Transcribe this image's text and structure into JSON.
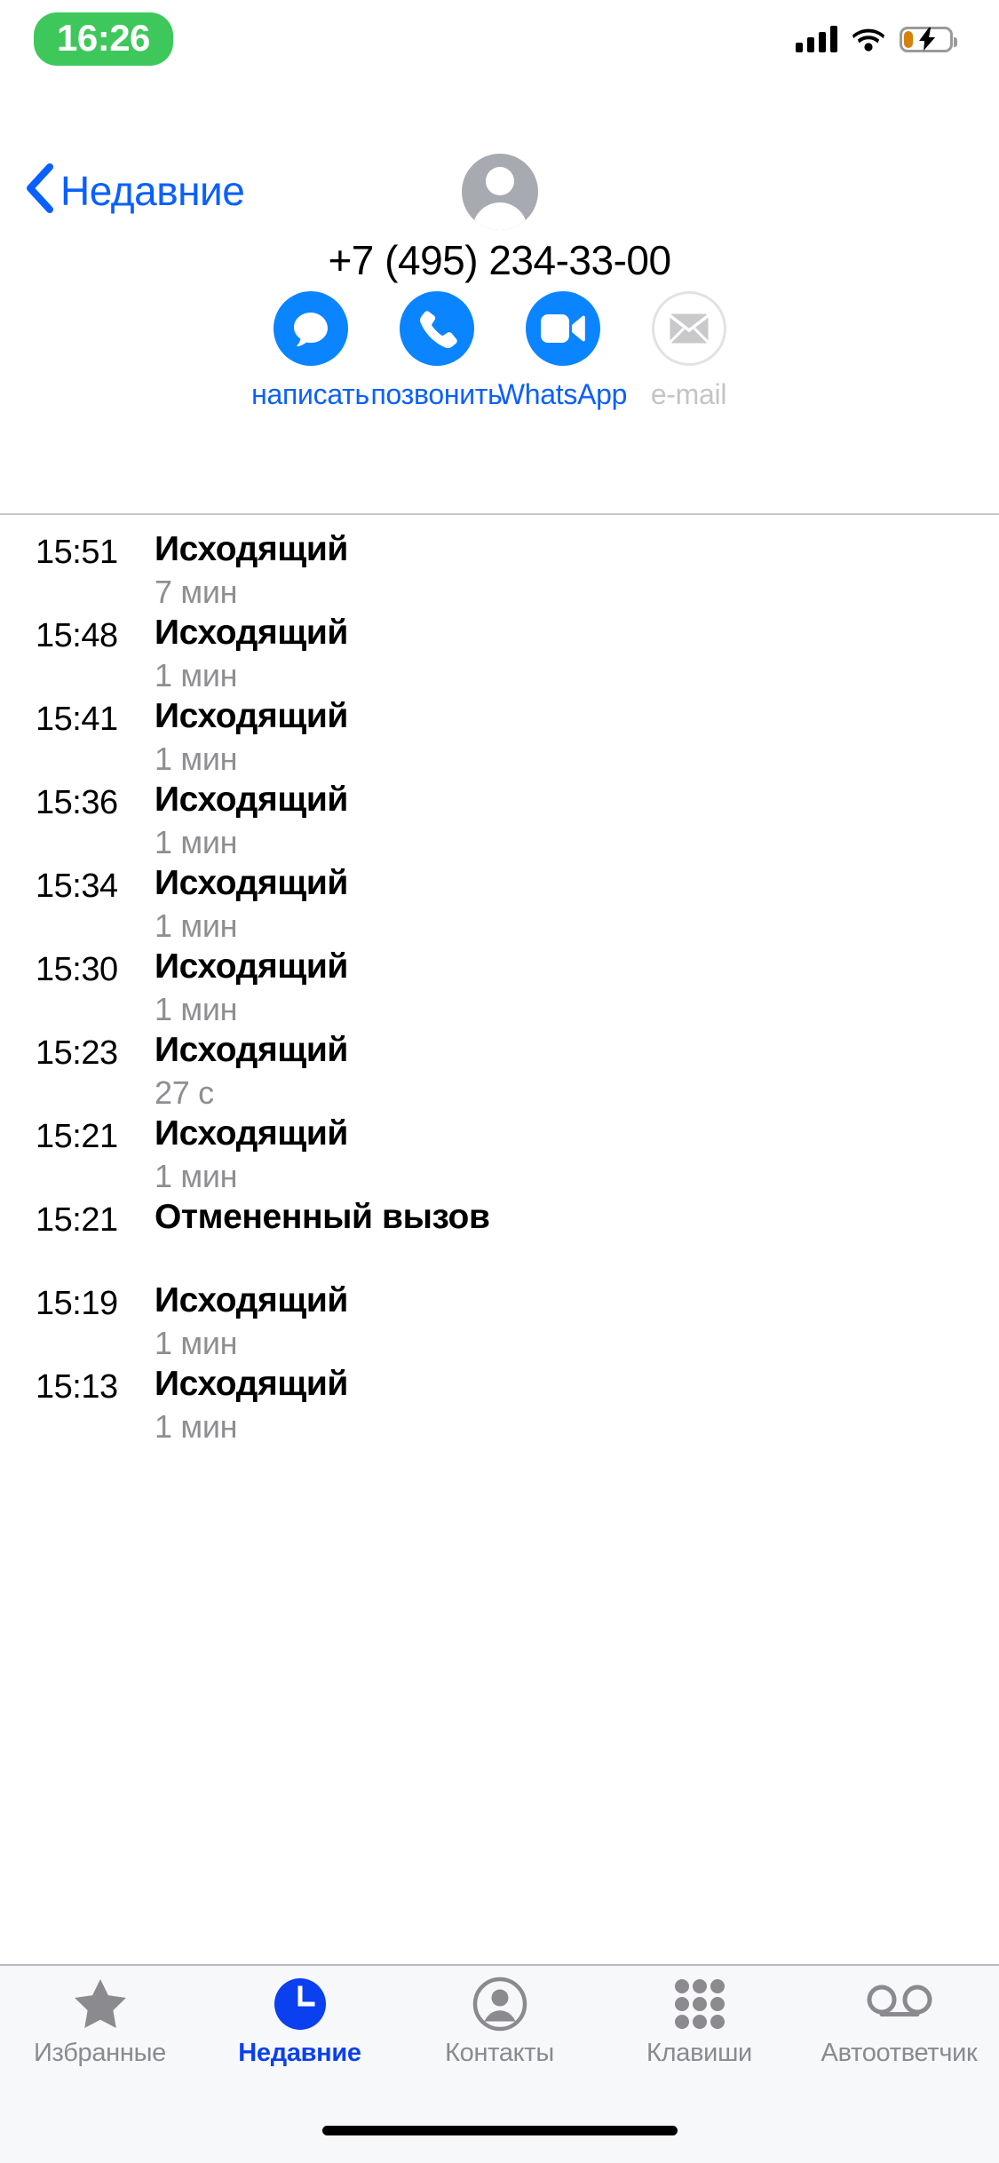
{
  "status_bar": {
    "time": "16:26",
    "time_pill_color": "#3ec85b",
    "signal_icon": "cellular-signal-icon",
    "wifi_icon": "wifi-icon",
    "battery_icon": "battery-charging-icon",
    "battery_fill_color": "#d4820a"
  },
  "nav": {
    "back_label": "Недавние",
    "back_chevron": "‹",
    "accent_color": "#0a60ff"
  },
  "contact": {
    "avatar_icon": "person-placeholder-avatar",
    "phone_number": "+7 (495) 234-33-00"
  },
  "actions": [
    {
      "label": "написать",
      "icon": "message-bubble-icon",
      "enabled": true
    },
    {
      "label": "позвонить",
      "icon": "phone-handset-icon",
      "enabled": true
    },
    {
      "label": "WhatsApp",
      "icon": "video-camera-icon",
      "enabled": true
    },
    {
      "label": "e-mail",
      "icon": "envelope-icon",
      "enabled": false
    }
  ],
  "calls": [
    {
      "time": "15:51",
      "type": "Исходящий",
      "duration": "7 мин"
    },
    {
      "time": "15:48",
      "type": "Исходящий",
      "duration": "1 мин"
    },
    {
      "time": "15:41",
      "type": "Исходящий",
      "duration": "1 мин"
    },
    {
      "time": "15:36",
      "type": "Исходящий",
      "duration": "1 мин"
    },
    {
      "time": "15:34",
      "type": "Исходящий",
      "duration": "1 мин"
    },
    {
      "time": "15:30",
      "type": "Исходящий",
      "duration": "1 мин"
    },
    {
      "time": "15:23",
      "type": "Исходящий",
      "duration": "27 с"
    },
    {
      "time": "15:21",
      "type": "Исходящий",
      "duration": "1 мин"
    },
    {
      "time": "15:21",
      "type": "Отмененный вызов",
      "duration": ""
    },
    {
      "time": "15:19",
      "type": "Исходящий",
      "duration": "1 мин"
    },
    {
      "time": "15:13",
      "type": "Исходящий",
      "duration": "1 мин"
    }
  ],
  "tabs": [
    {
      "label": "Избранные",
      "icon": "star-icon",
      "active": false
    },
    {
      "label": "Недавние",
      "icon": "clock-icon",
      "active": true
    },
    {
      "label": "Контакты",
      "icon": "person-icon",
      "active": false
    },
    {
      "label": "Клавиши",
      "icon": "keypad-icon",
      "active": false
    },
    {
      "label": "Автоответчик",
      "icon": "voicemail-icon",
      "active": false
    }
  ],
  "home_indicator": "home-indicator-bar"
}
